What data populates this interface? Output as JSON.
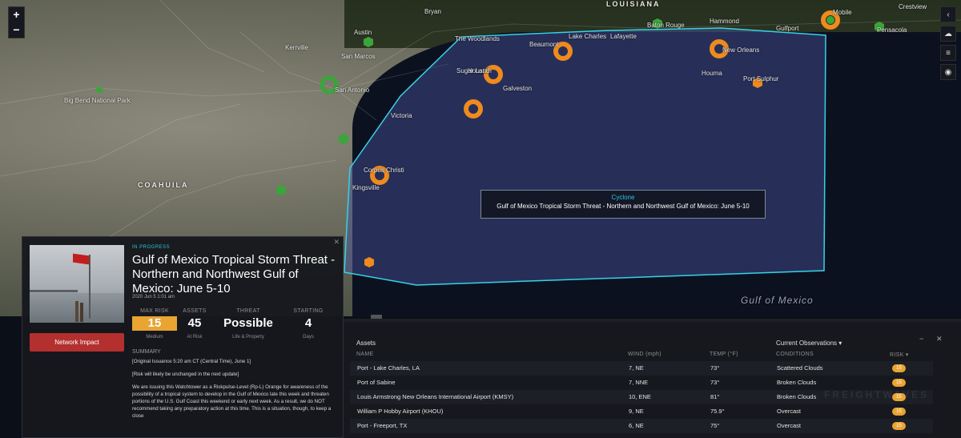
{
  "map": {
    "zoom_in": "+",
    "zoom_out": "−",
    "labels": {
      "louisiana": "LOUISIANA",
      "coahuila": "COAHUILA",
      "austin": "Austin",
      "san_antonio": "San Antonio",
      "houston": "Houston",
      "galveston": "Galveston",
      "beaumont": "Beaumont",
      "lake_charles": "Lake Charles",
      "lafayette": "Lafayette",
      "baton_rouge": "Baton Rouge",
      "new_orleans": "New Orleans",
      "gulfport": "Gulfport",
      "mobile": "Mobile",
      "pensacola": "Pensacola",
      "crestview": "Crestview",
      "hammond": "Hammond",
      "houma": "Houma",
      "port_sulphur": "Port Sulphur",
      "victoria": "Victoria",
      "corpus_christi": "Corpus Christi",
      "kingsville": "Kingsville",
      "big_bend": "Big Bend National Park",
      "sugar_land": "Sugar Land",
      "the_woodlands": "The Woodlands",
      "bryan": "Bryan",
      "kerrville": "Kerrville",
      "san_marcos": "San Marcos",
      "gulf_of_mexico": "Gulf of Mexico"
    },
    "tooltip": {
      "type": "Cyclone",
      "title": "Gulf of Mexico Tropical Storm Threat - Northern and Northwest Gulf of Mexico: June 5-10"
    },
    "colors": {
      "storm_outline": "#34d3e6",
      "storm_fill": "#4a55a0",
      "risk_orange": "#ef8a1e",
      "ok_green": "#3aa53a"
    }
  },
  "event": {
    "status": "IN PROGRESS",
    "title": "Gulf of Mexico Tropical Storm Threat - Northern and Northwest Gulf of Mexico: June 5-10",
    "issued": "2020 Jun 5 1:01 am",
    "network_button": "Network Impact",
    "metrics": {
      "max_risk": {
        "label": "MAX RISK",
        "value": "15",
        "sub": "Medium"
      },
      "assets": {
        "label": "ASSETS",
        "value": "45",
        "sub": "At Risk"
      },
      "threat": {
        "label": "THREAT",
        "value": "Possible",
        "sub": "Life & Property"
      },
      "starting": {
        "label": "STARTING",
        "value": "4",
        "sub": "Days"
      }
    },
    "summary_heading": "SUMMARY",
    "summary_paragraphs": [
      "[Original Issuance 5:20 am CT (Central Time), June 1]",
      "[Risk will likely be unchanged in the next update]",
      "We are issuing this Watchtower as a Riskpulse-Level (Rp-L) Orange for awareness of the possibility of a tropical system to develop in the Gulf of Mexico late this week and threaten portions of the U.S. Gulf Coast this weekend or early next week. As a result, we do NOT recommend taking any preparatory action at this time. This is a situation, though, to keep a close"
    ]
  },
  "assets": {
    "title": "Assets",
    "obs_menu": "Current Observations ▾",
    "minimize": "−",
    "close": "✕",
    "columns": {
      "name": "NAME",
      "wind": "WIND (mph)",
      "temp": "TEMP (°F)",
      "conditions": "CONDITIONS",
      "risk": "RISK ▾"
    },
    "rows": [
      {
        "name": "Port - Lake Charles, LA",
        "wind": "7, NE",
        "temp": "73°",
        "conditions": "Scattered Clouds",
        "risk": "15"
      },
      {
        "name": "Port of Sabine",
        "wind": "7, NNE",
        "temp": "73°",
        "conditions": "Broken Clouds",
        "risk": "15"
      },
      {
        "name": "Louis Armstrong New Orleans International Airport (KMSY)",
        "wind": "10, ENE",
        "temp": "81°",
        "conditions": "Broken Clouds",
        "risk": "15"
      },
      {
        "name": "William P Hobby Airport (KHOU)",
        "wind": "9, NE",
        "temp": "75.9°",
        "conditions": "Overcast",
        "risk": "15"
      },
      {
        "name": "Port - Freeport, TX",
        "wind": "6, NE",
        "temp": "75°",
        "conditions": "Overcast",
        "risk": "15"
      }
    ],
    "watermark": "FREIGHTWAVES"
  }
}
